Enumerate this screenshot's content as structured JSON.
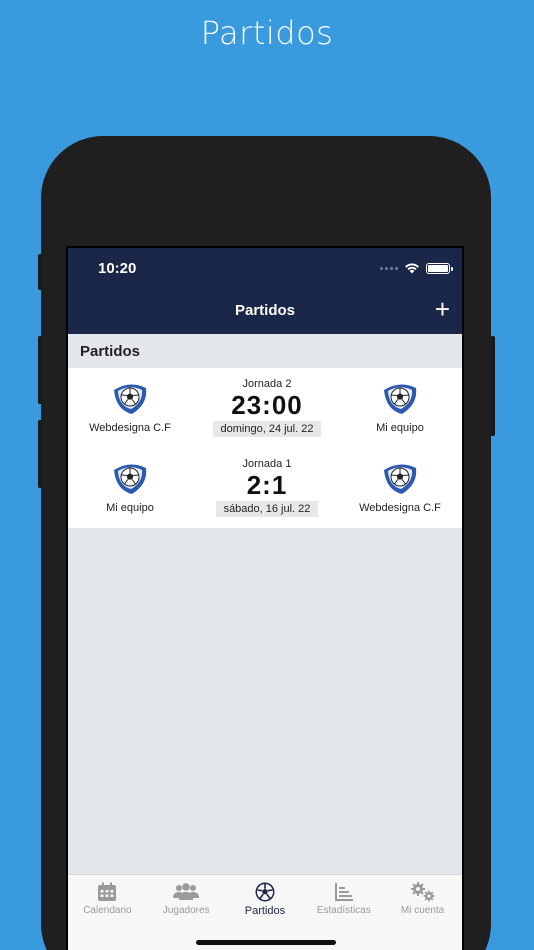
{
  "promo": {
    "title": "Partidos"
  },
  "status_bar": {
    "time": "10:20"
  },
  "nav": {
    "title": "Partidos",
    "add_label": "+"
  },
  "section": {
    "title": "Partidos"
  },
  "matches": [
    {
      "home": "Webdesigna C.F",
      "away": "Mi equipo",
      "round": "Jornada 2",
      "score": "23:00",
      "date": "domingo, 24 jul. 22"
    },
    {
      "home": "Mi equipo",
      "away": "Webdesigna C.F",
      "round": "Jornada 1",
      "score": "2:1",
      "date": "sábado, 16 jul. 22"
    }
  ],
  "tabs": [
    {
      "label": "Calendario",
      "icon": "calendar-icon",
      "active": false
    },
    {
      "label": "Jugadores",
      "icon": "players-icon",
      "active": false
    },
    {
      "label": "Partidos",
      "icon": "soccer-ball-icon",
      "active": true
    },
    {
      "label": "Estadísticas",
      "icon": "chart-icon",
      "active": false
    },
    {
      "label": "Mi cuenta",
      "icon": "gears-icon",
      "active": false
    }
  ],
  "colors": {
    "background": "#3a9ade",
    "navbar": "#1b2749",
    "tab_active": "#1b2749",
    "tab_inactive": "#9a9a9a"
  }
}
